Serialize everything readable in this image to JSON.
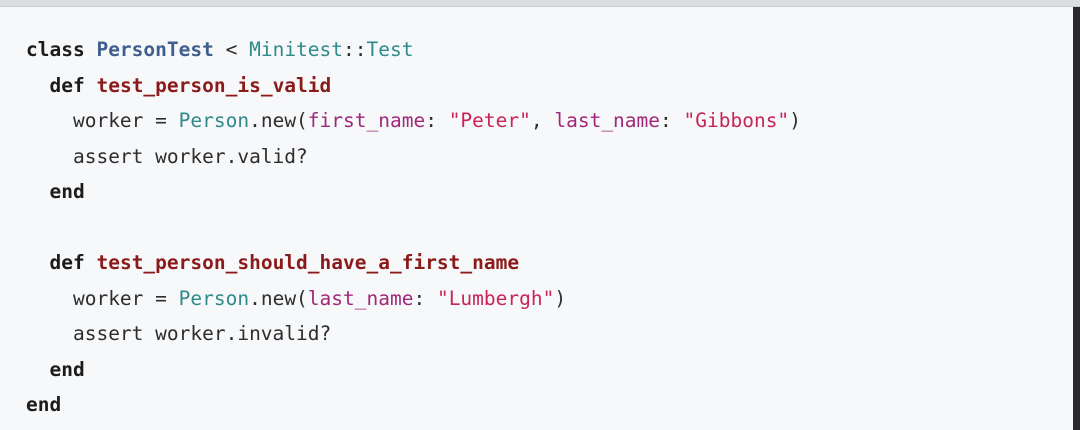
{
  "code": {
    "lines": [
      {
        "t1": "class",
        "t2": " ",
        "t3": "PersonTest",
        "t4": " < ",
        "t5": "Minitest",
        "t6": "::",
        "t7": "Test"
      },
      {
        "t1": "def",
        "t2": " ",
        "t3": "test_person_is_valid"
      },
      {
        "t1": "worker = ",
        "t2": "Person",
        "t3": ".new(",
        "t4": "first_name",
        "t5": ": ",
        "t6": "\"Peter\"",
        "t7": ", ",
        "t8": "last_name",
        "t9": ": ",
        "t10": "\"Gibbons\"",
        "t11": ")"
      },
      {
        "t1": "assert worker.valid?"
      },
      {
        "t1": "end"
      },
      {},
      {
        "t1": "def",
        "t2": " ",
        "t3": "test_person_should_have_a_first_name"
      },
      {
        "t1": "worker = ",
        "t2": "Person",
        "t3": ".new(",
        "t4": "last_name",
        "t5": ": ",
        "t6": "\"Lumbergh\"",
        "t7": ")"
      },
      {
        "t1": "assert worker.invalid?"
      },
      {
        "t1": "end"
      },
      {
        "t1": "end"
      }
    ]
  }
}
